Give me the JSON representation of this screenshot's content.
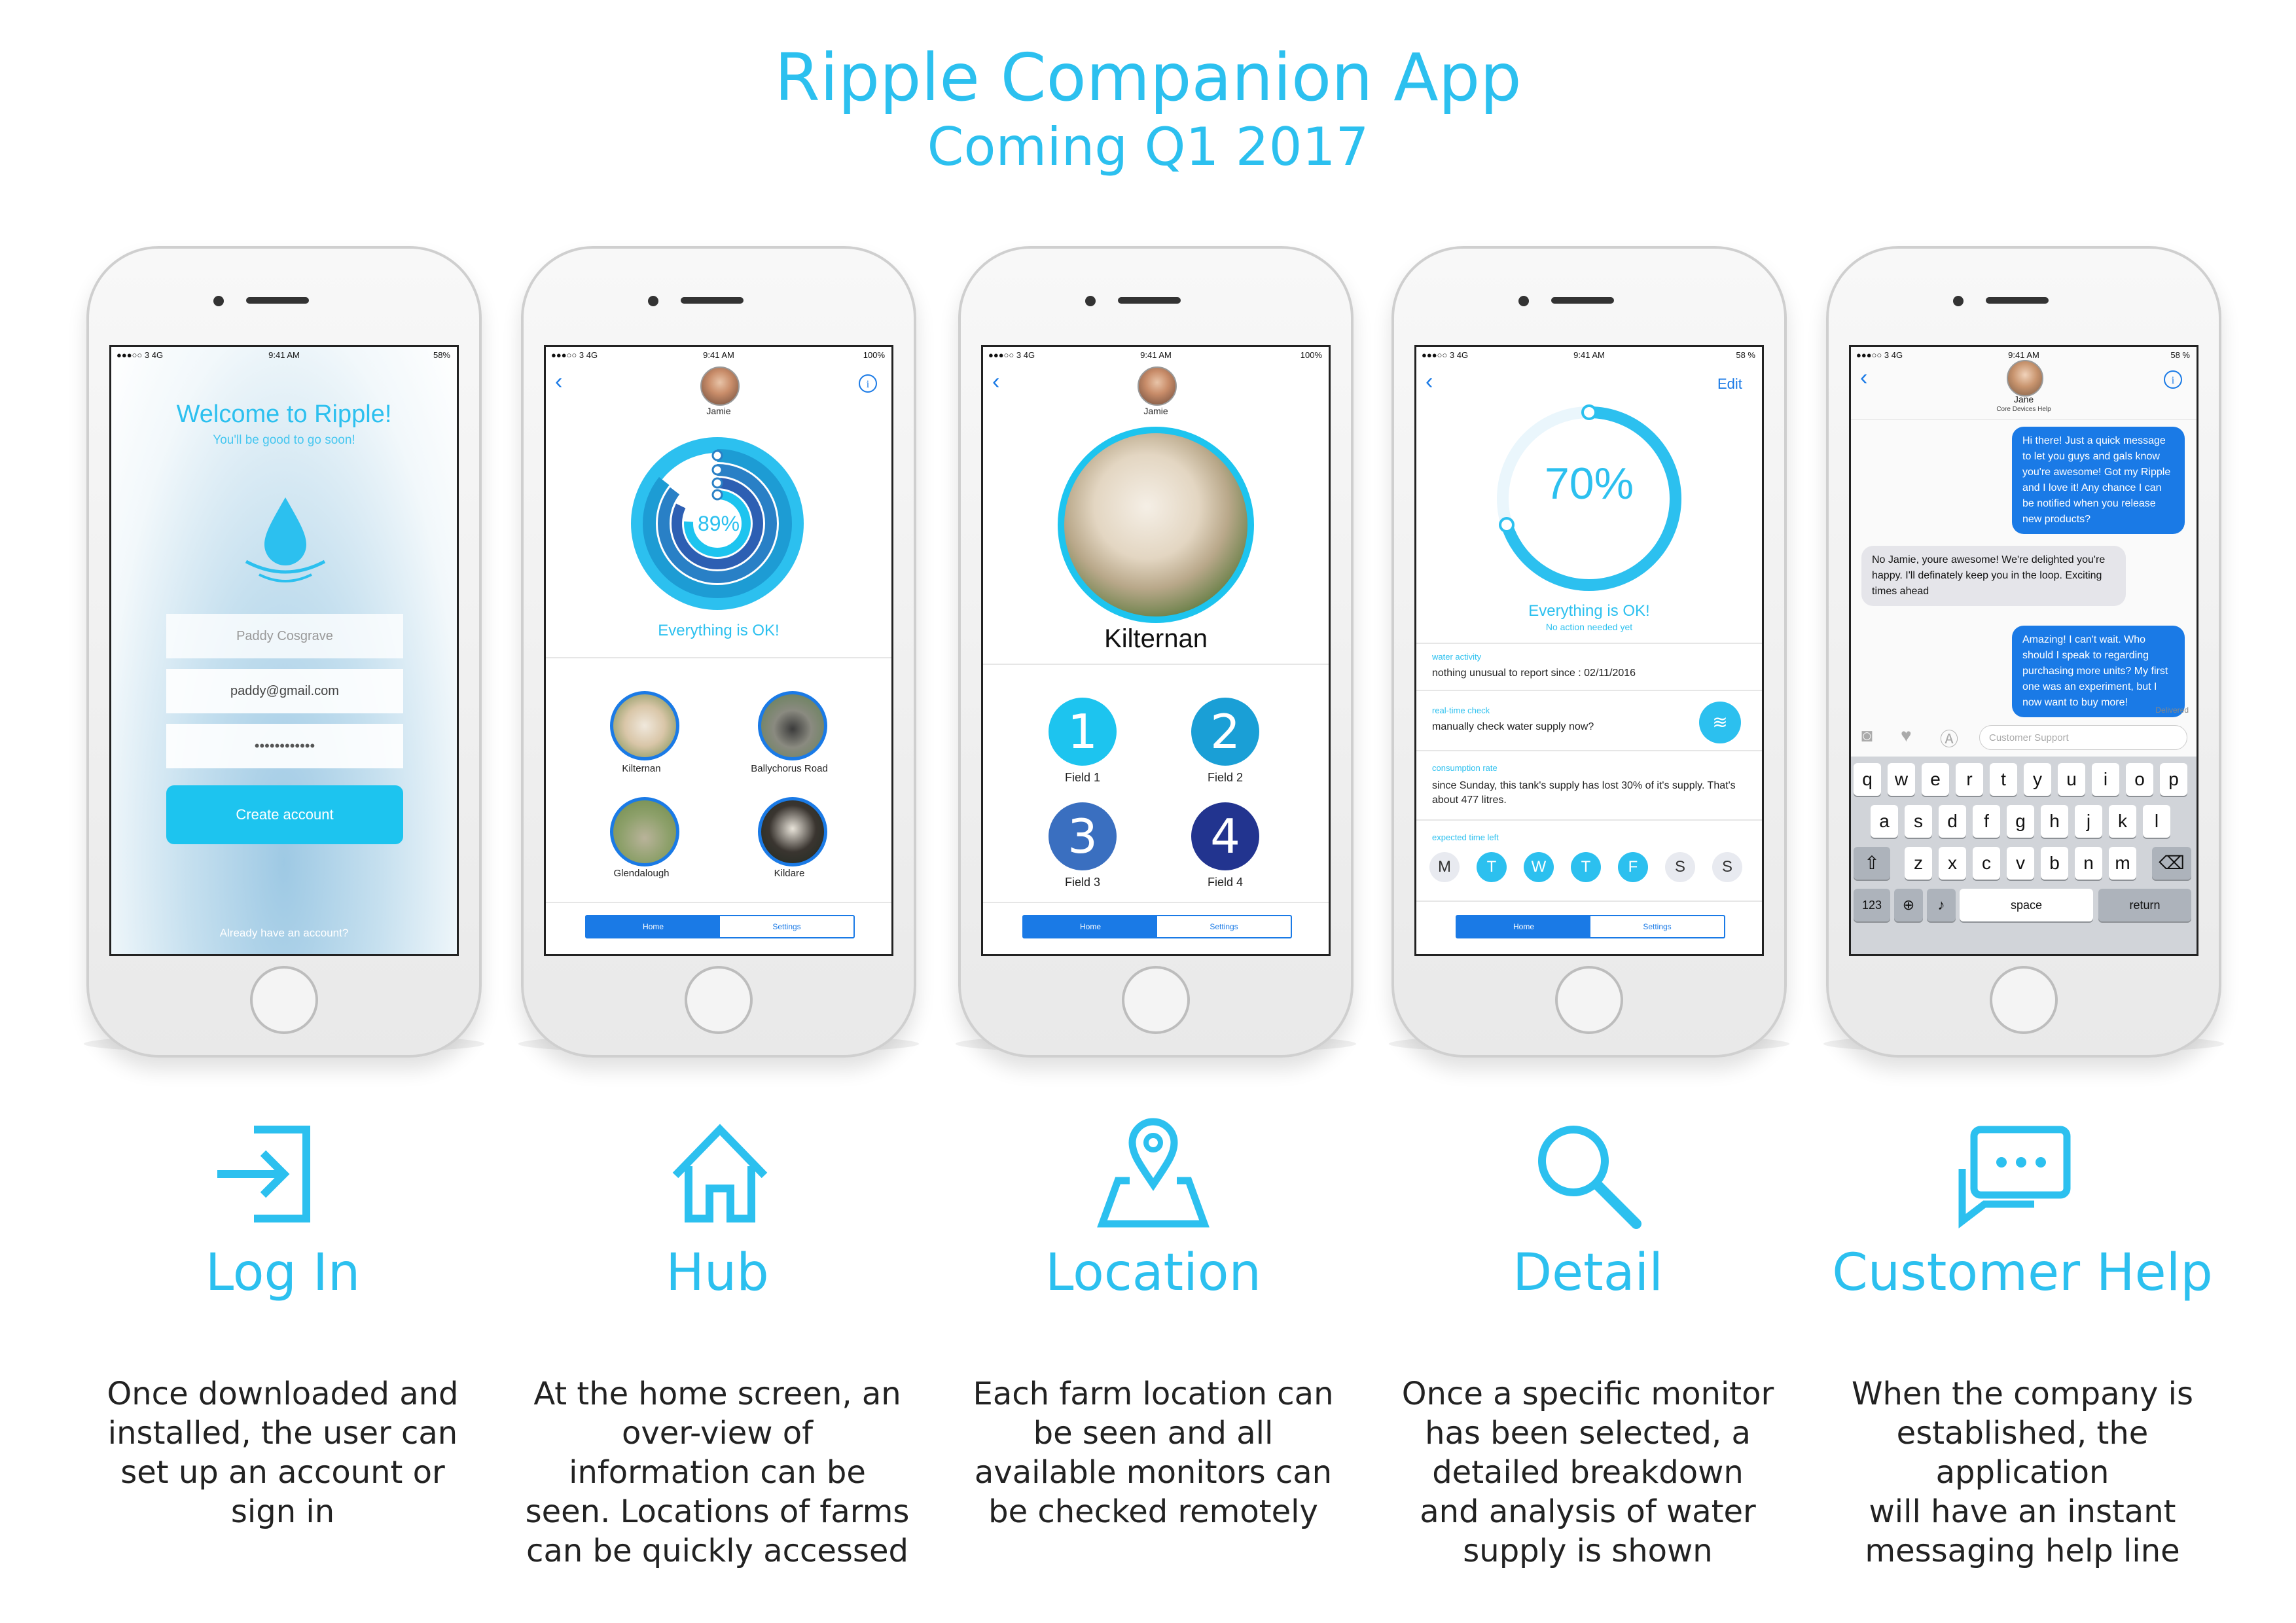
{
  "header": {
    "title": "Ripple Companion App",
    "subtitle": "Coming Q1 2017"
  },
  "status": {
    "p1": {
      "left": "●●●○○ 3 4G",
      "time": "9:41 AM",
      "right": "58%"
    },
    "p2": {
      "left": "●●●○○ 3 4G",
      "time": "9:41 AM",
      "right": "100%"
    },
    "p3": {
      "left": "●●●○○ 3 4G",
      "time": "9:41 AM",
      "right": "100%"
    },
    "p4": {
      "left": "●●●○○ 3 4G",
      "time": "9:41 AM",
      "right": "58 %"
    },
    "p5": {
      "left": "●●●○○ 3 4G",
      "time": "9:41 AM",
      "right": "58 %"
    }
  },
  "login": {
    "welcome": "Welcome to Ripple!",
    "sub": "You'll be good to go soon!",
    "name": "Paddy Cosgrave",
    "email": "paddy@gmail.com",
    "password": "••••••••••••",
    "create": "Create account",
    "already": "Already have an account?"
  },
  "hub": {
    "user": "Jamie",
    "percent": "89%",
    "status": "Everything is OK!",
    "locations": [
      "Kilternan",
      "Ballychorus Road",
      "Glendalough",
      "Kildare"
    ],
    "tab_home": "Home",
    "tab_settings": "Settings"
  },
  "location": {
    "user": "Jamie",
    "name": "Kilternan",
    "fields": [
      {
        "num": "1",
        "label": "Field 1"
      },
      {
        "num": "2",
        "label": "Field 2"
      },
      {
        "num": "3",
        "label": "Field 3"
      },
      {
        "num": "4",
        "label": "Field 4"
      }
    ],
    "tab_home": "Home",
    "tab_settings": "Settings"
  },
  "detail": {
    "edit": "Edit",
    "percent": "70%",
    "percent_value": 0.7,
    "status": "Everything is OK!",
    "sub": "No action needed yet",
    "water_activity_h": "water activity",
    "water_activity": "nothing unusual to report since : 02/11/2016",
    "realtime_h": "real-time check",
    "realtime": "manually check water supply now?",
    "consumption_h": "consumption rate",
    "consumption": "since Sunday, this tank's supply has lost 30% of it's supply. That's about 477 litres.",
    "expected_h": "expected time left",
    "days": [
      "M",
      "T",
      "W",
      "T",
      "F",
      "S",
      "S"
    ],
    "tab_home": "Home",
    "tab_settings": "Settings"
  },
  "help": {
    "name": "Jane",
    "role": "Core Devices Help",
    "msg1": "Hi there! Just a quick message to let you guys and gals know you're awesome! Got my Ripple and I love it! Any chance I can be notified when you release new products?",
    "msg2": "No Jamie, youre awesome! We're delighted you're happy. I'll definately keep you in the loop. Exciting times ahead",
    "msg3": "Amazing! I can't wait. Who should I speak to regarding purchasing more units? My first one was an experiment, but I now want to buy more!",
    "delivered": "Delivered",
    "input_placeholder": "Customer Support",
    "row1": [
      "q",
      "w",
      "e",
      "r",
      "t",
      "y",
      "u",
      "i",
      "o",
      "p"
    ],
    "row2": [
      "a",
      "s",
      "d",
      "f",
      "g",
      "h",
      "j",
      "k",
      "l"
    ],
    "row3": [
      "z",
      "x",
      "c",
      "v",
      "b",
      "n",
      "m"
    ],
    "k123": "123",
    "space": "space",
    "return": "return"
  },
  "features": [
    {
      "title": "Log In",
      "desc": [
        "Once downloaded and",
        "installed, the user can",
        "set up an account or",
        "sign in"
      ]
    },
    {
      "title": "Hub",
      "desc": [
        "At the home screen, an",
        "over-view of",
        "information can be",
        "seen. Locations of farms",
        "can be quickly accessed"
      ]
    },
    {
      "title": "Location",
      "desc": [
        "Each farm location can",
        "be seen and all",
        "available monitors can",
        "be checked remotely"
      ]
    },
    {
      "title": "Detail",
      "desc": [
        "Once a specific monitor",
        "has been selected, a",
        "detailed breakdown",
        "and analysis of water",
        "supply is shown"
      ]
    },
    {
      "title": "Customer Help",
      "desc": [
        "When the company is",
        "established, the application",
        "will have an instant",
        "messaging help line"
      ]
    }
  ],
  "colors": {
    "accent": "#2cc0ef",
    "ios_blue": "#1a7ae6",
    "field1": "#1dc4ef",
    "field2": "#1a9fd6",
    "field3": "#3a6fc0",
    "field4": "#22348f"
  }
}
